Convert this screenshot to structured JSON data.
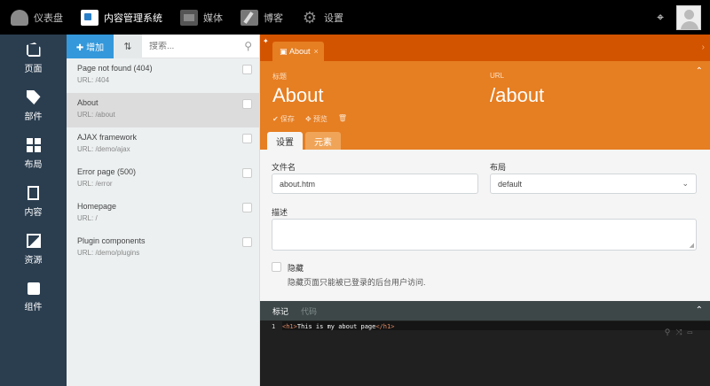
{
  "topbar": {
    "items": [
      {
        "label": "仪表盘",
        "icon": "dashboard-icon"
      },
      {
        "label": "内容管理系统",
        "icon": "cms-icon",
        "active": true
      },
      {
        "label": "媒体",
        "icon": "media-icon"
      },
      {
        "label": "博客",
        "icon": "blog-icon"
      },
      {
        "label": "设置",
        "icon": "gear-icon"
      }
    ],
    "crosshair": "⌖"
  },
  "sidebar": {
    "items": [
      {
        "label": "页面",
        "icon": "pages-icon"
      },
      {
        "label": "部件",
        "icon": "partials-icon"
      },
      {
        "label": "布局",
        "icon": "layouts-icon"
      },
      {
        "label": "内容",
        "icon": "content-icon"
      },
      {
        "label": "资源",
        "icon": "assets-icon"
      },
      {
        "label": "组件",
        "icon": "components-icon"
      }
    ]
  },
  "list": {
    "add_label": "✚ 增加",
    "sort_label": "⇅",
    "search_placeholder": "搜索...",
    "items": [
      {
        "title": "Page not found (404)",
        "url": "URL: /404"
      },
      {
        "title": "About",
        "url": "URL: /about",
        "active": true
      },
      {
        "title": "AJAX framework",
        "url": "URL: /demo/ajax"
      },
      {
        "title": "Error page (500)",
        "url": "URL: /error"
      },
      {
        "title": "Homepage",
        "url": "URL: /"
      },
      {
        "title": "Plugin components",
        "url": "URL: /demo/plugins"
      }
    ]
  },
  "main": {
    "tab_label": "About",
    "tab_close": "×",
    "title_label": "标题",
    "title_value": "About",
    "url_label": "URL",
    "url_value": "/about",
    "actions": {
      "save": "✔ 保存",
      "preview": "✥ 预览",
      "delete": "🗑"
    },
    "subtabs": {
      "settings": "设置",
      "meta": "元素"
    },
    "form": {
      "filename_label": "文件名",
      "filename_value": "about.htm",
      "layout_label": "布局",
      "layout_value": "default",
      "description_label": "描述",
      "hidden_label": "隐藏",
      "hidden_help": "隐藏页面只能被已登录的后台用户访问."
    },
    "code": {
      "tabs": {
        "markup": "标记",
        "code": "代码"
      },
      "line_number": "1",
      "open_tag": "<h1>",
      "text": "This is my about page",
      "close_tag": "</h1>"
    }
  },
  "colors": {
    "accent_orange": "#e67e22",
    "dark_orange": "#d35400",
    "sidebar": "#2b3e50",
    "add_button": "#3498db"
  }
}
